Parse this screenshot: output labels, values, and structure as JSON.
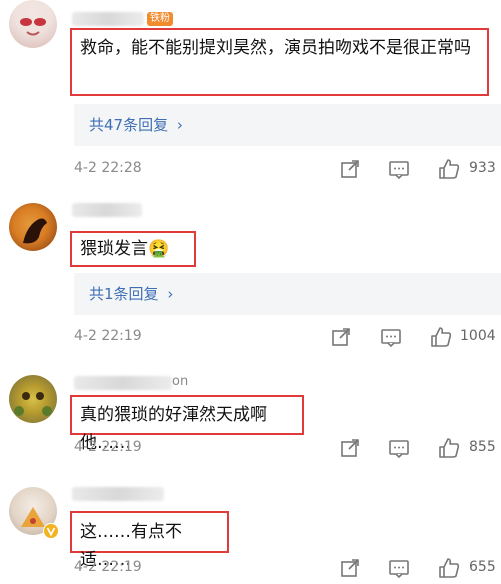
{
  "comments": [
    {
      "username_suffix": "",
      "badge": "铁粉",
      "text": "救命，能不能别提刘昊然，演员拍吻戏不是很正常吗",
      "reply_label": "共47条回复",
      "time": "4-2 22:28",
      "likes": "933"
    },
    {
      "username_suffix": "",
      "text": "猥琐发言",
      "emoji": "🤮",
      "reply_label": "共1条回复",
      "time": "4-2 22:19",
      "likes": "1004"
    },
    {
      "username_suffix": "on",
      "text": "真的猥琐的好渾然天成啊他……",
      "time": "4-2 22:19",
      "likes": "855"
    },
    {
      "username_suffix": "",
      "text": "这……有点不适……",
      "time": "4-2 22:19",
      "likes": "655"
    }
  ],
  "icons": {
    "share": "share-icon",
    "comment": "comment-icon",
    "like": "like-icon",
    "reply_chevron": "chevron-right-icon"
  },
  "colors": {
    "highlight_border": "#e03a3a",
    "link": "#3f6fb5",
    "reply_bg": "#f4f5f7",
    "badge": "#f28a2e"
  }
}
